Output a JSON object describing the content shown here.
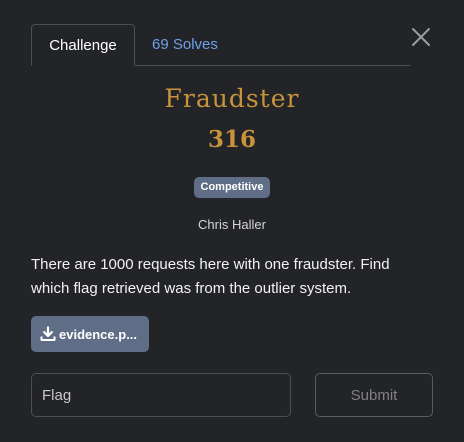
{
  "tabs": {
    "challenge_label": "Challenge",
    "solves_label": "69 Solves"
  },
  "challenge": {
    "name": "Fraudster",
    "points": "316",
    "category_badge": "Competitive",
    "author": "Chris Haller",
    "description": "There are 1000 requests here with one fraudster. Find which flag retrieved was from the outlier system.",
    "file_label": "evidence.p..."
  },
  "form": {
    "flag_placeholder": "Flag",
    "submit_label": "Submit"
  },
  "icons": {
    "close": "close-icon",
    "download": "download-icon"
  },
  "colors": {
    "background": "#232427",
    "accent_gold": "#c8933a",
    "link_blue": "#6fa0e6",
    "badge_slate": "#5f6e86"
  }
}
